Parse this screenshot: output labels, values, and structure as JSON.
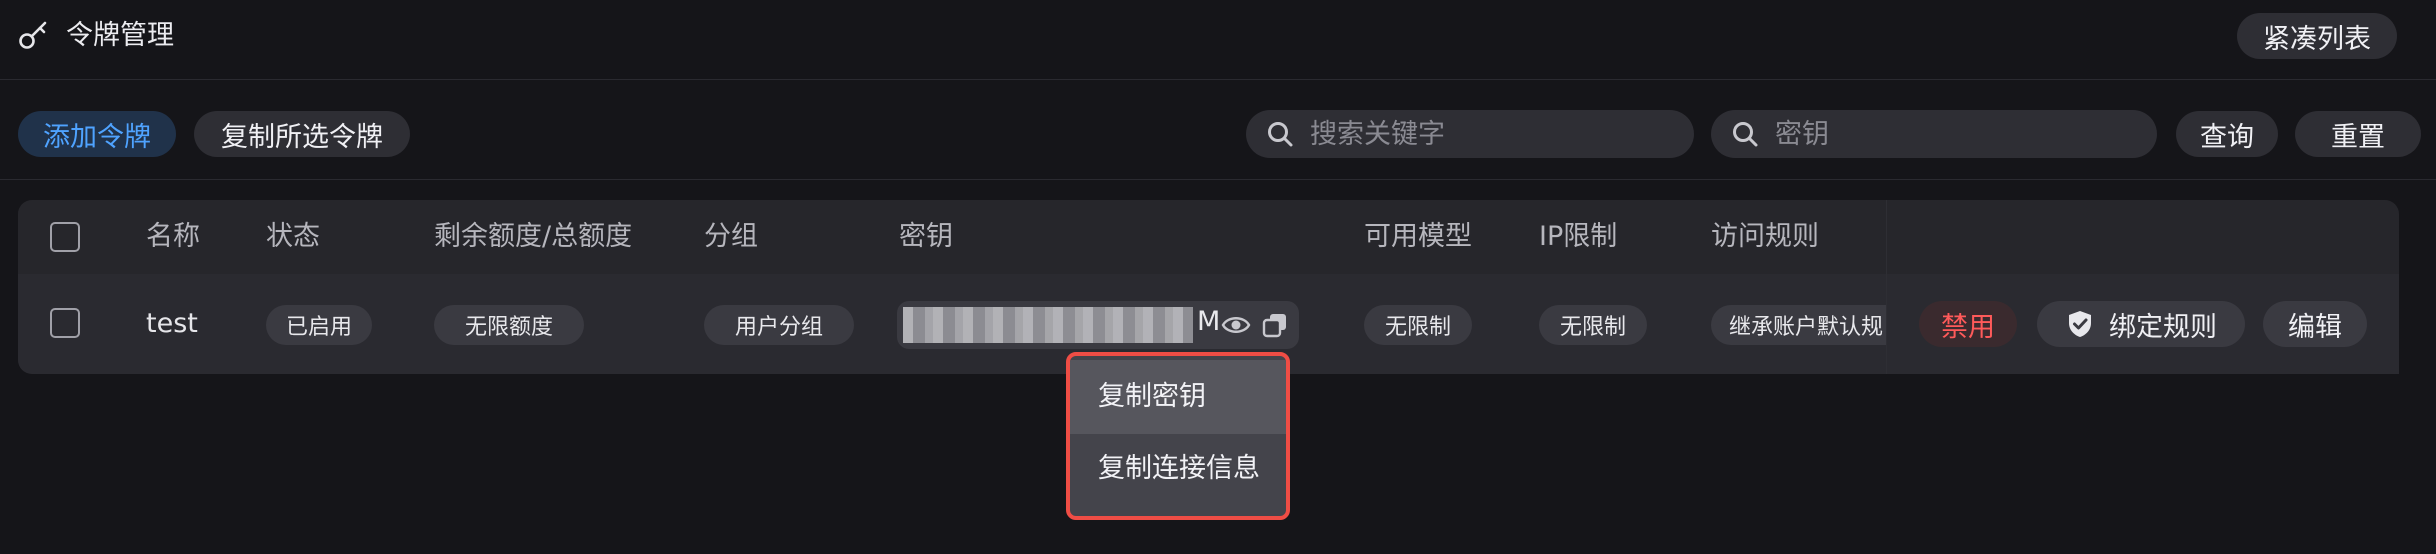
{
  "header": {
    "title": "令牌管理",
    "compact_label": "紧凑列表",
    "icon": "key-icon"
  },
  "toolbar": {
    "add_label": "添加令牌",
    "copy_selected_label": "复制所选令牌",
    "search_keyword_placeholder": "搜索关键字",
    "search_key_placeholder": "密钥",
    "query_label": "查询",
    "reset_label": "重置"
  },
  "table": {
    "columns": [
      "名称",
      "状态",
      "剩余额度/总额度",
      "分组",
      "密钥",
      "可用模型",
      "IP限制",
      "访问规则"
    ],
    "rows": [
      {
        "name": "test",
        "status": "已启用",
        "quota": "无限额度",
        "group": "用户分组",
        "key_suffix": "M",
        "models": "无限制",
        "ip_limit": "无限制",
        "access_rule": "继承账户默认规"
      }
    ],
    "actions": {
      "disable_label": "禁用",
      "bind_label": "绑定规则",
      "edit_label": "编辑"
    }
  },
  "dropdown": {
    "items": [
      "复制密钥",
      "复制连接信息"
    ]
  },
  "colors": {
    "background": "#151519",
    "accent": "#4fa3ff",
    "danger": "#ff5a5a",
    "highlight_border": "#ef4d45"
  }
}
